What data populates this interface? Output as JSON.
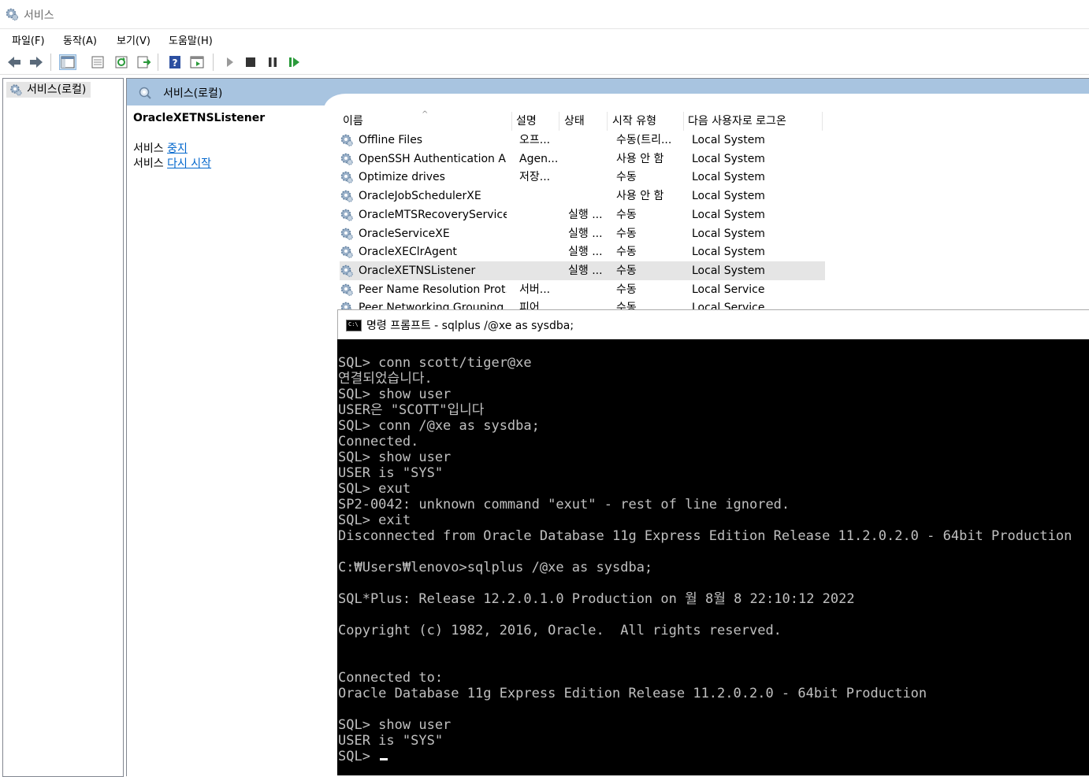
{
  "window": {
    "title": "서비스"
  },
  "menu": [
    "파일(F)",
    "동작(A)",
    "보기(V)",
    "도움말(H)"
  ],
  "toolbar": {
    "icons": [
      "back-icon",
      "forward-icon",
      "console-tree-icon",
      "properties-icon",
      "refresh-icon",
      "export-icon",
      "help-icon",
      "view-icon",
      "play-icon",
      "stop-icon",
      "pause-icon",
      "resume-icon"
    ]
  },
  "tree": {
    "root_label": "서비스(로컬)"
  },
  "header": {
    "title": "서비스(로컬)"
  },
  "details": {
    "service_name": "OracleXETNSListener",
    "stop_prefix": "서비스",
    "stop_link": "중지",
    "restart_prefix": "서비스",
    "restart_link": "다시 시작"
  },
  "table": {
    "columns": [
      "이름",
      "설명",
      "상태",
      "시작 유형",
      "다음 사용자로 로그온"
    ],
    "rows": [
      {
        "name": "Offline Files",
        "desc": "오프...",
        "status": "",
        "startup": "수동(트리...",
        "logon": "Local System"
      },
      {
        "name": "OpenSSH Authentication A...",
        "desc": "Agen...",
        "status": "",
        "startup": "사용 안 함",
        "logon": "Local System"
      },
      {
        "name": "Optimize drives",
        "desc": "저장...",
        "status": "",
        "startup": "수동",
        "logon": "Local System"
      },
      {
        "name": "OracleJobSchedulerXE",
        "desc": "",
        "status": "",
        "startup": "사용 안 함",
        "logon": "Local System"
      },
      {
        "name": "OracleMTSRecoveryService",
        "desc": "",
        "status": "실행 ...",
        "startup": "수동",
        "logon": "Local System"
      },
      {
        "name": "OracleServiceXE",
        "desc": "",
        "status": "실행 ...",
        "startup": "수동",
        "logon": "Local System"
      },
      {
        "name": "OracleXEClrAgent",
        "desc": "",
        "status": "실행 ...",
        "startup": "수동",
        "logon": "Local System"
      },
      {
        "name": "OracleXETNSListener",
        "desc": "",
        "status": "실행 ...",
        "startup": "수동",
        "logon": "Local System"
      },
      {
        "name": "Peer Name Resolution Prot...",
        "desc": "서버...",
        "status": "",
        "startup": "수동",
        "logon": "Local Service"
      },
      {
        "name": "Peer Networking Grouping",
        "desc": "피어...",
        "status": "",
        "startup": "수동",
        "logon": "Local Service"
      }
    ]
  },
  "cmd": {
    "title": "명령 프롬프트 - sqlplus  /@xe as sysdba;",
    "icon_text": "C:\\",
    "lines": [
      "SQL> conn scott/tiger@xe",
      "연결되었습니다.",
      "SQL> show user",
      "USER은 \"SCOTT\"입니다",
      "SQL> conn /@xe as sysdba;",
      "Connected.",
      "SQL> show user",
      "USER is \"SYS\"",
      "SQL> exut",
      "SP2-0042: unknown command \"exut\" - rest of line ignored.",
      "SQL> exit",
      "Disconnected from Oracle Database 11g Express Edition Release 11.2.0.2.0 - 64bit Production",
      "",
      "C:₩Users₩lenovo>sqlplus /@xe as sysdba;",
      "",
      "SQL*Plus: Release 12.2.0.1.0 Production on 월 8월 8 22:10:12 2022",
      "",
      "Copyright (c) 1982, 2016, Oracle.  All rights reserved.",
      "",
      "",
      "Connected to:",
      "Oracle Database 11g Express Edition Release 11.2.0.2.0 - 64bit Production",
      "",
      "SQL> show user",
      "USER is \"SYS\"",
      "SQL> "
    ]
  },
  "colors": {
    "header_band": "#a8c4e0",
    "link": "#0066cc",
    "console_bg": "#000000",
    "console_fg": "#c0c0c0",
    "selected_row": "#e5e5e5"
  }
}
